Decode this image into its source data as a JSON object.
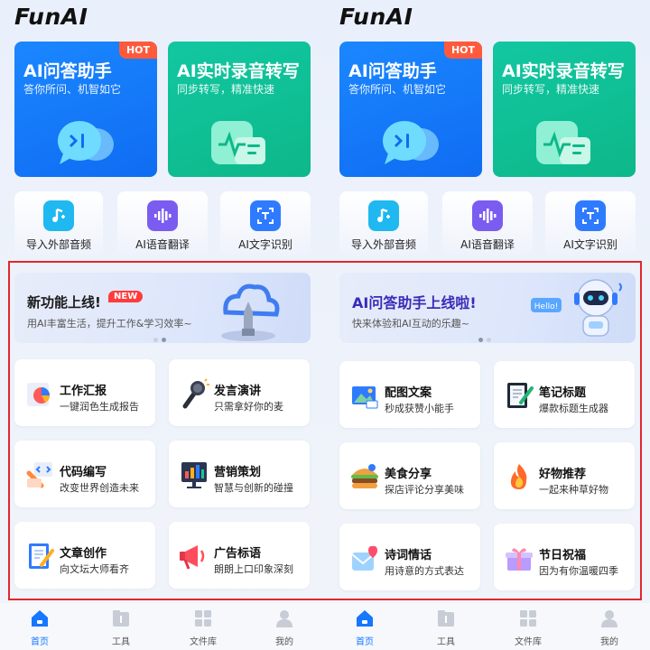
{
  "left": {
    "brand": "FunAI",
    "cards": [
      {
        "title": "AI问答助手",
        "subtitle": "答你所问、机智如它",
        "badge": "HOT",
        "icon": "chat-bubble-icon"
      },
      {
        "title": "AI实时录音转写",
        "subtitle": "同步转写，精准快速",
        "icon": "voice-transcribe-icon"
      }
    ],
    "tools": [
      {
        "label": "导入外部音频",
        "icon": "music-import-icon"
      },
      {
        "label": "AI语音翻译",
        "icon": "voice-wave-icon"
      },
      {
        "label": "AI文字识别",
        "icon": "text-scan-icon"
      }
    ],
    "banner": {
      "title": "新功能上线!",
      "badge": "NEW",
      "subtitle": "用AI丰富生活，提升工作&学习效率~",
      "icon": "cloud-rocket-icon"
    },
    "features": [
      {
        "title": "工作汇报",
        "subtitle": "一键润色生成报告",
        "icon": "report-chart-icon"
      },
      {
        "title": "发言演讲",
        "subtitle": "只需拿好你的麦",
        "icon": "microphone-icon"
      },
      {
        "title": "代码编写",
        "subtitle": "改变世界创造未来",
        "icon": "code-icon"
      },
      {
        "title": "营销策划",
        "subtitle": "智慧与创新的碰撞",
        "icon": "marketing-chart-icon"
      },
      {
        "title": "文章创作",
        "subtitle": "向文坛大师看齐",
        "icon": "article-pen-icon"
      },
      {
        "title": "广告标语",
        "subtitle": "朗朗上口印象深刻",
        "icon": "megaphone-icon"
      }
    ]
  },
  "right": {
    "brand": "FunAI",
    "cards": [
      {
        "title": "AI问答助手",
        "subtitle": "答你所问、机智如它",
        "badge": "HOT",
        "icon": "chat-bubble-icon"
      },
      {
        "title": "AI实时录音转写",
        "subtitle": "同步转写，精准快速",
        "icon": "voice-transcribe-icon"
      }
    ],
    "tools": [
      {
        "label": "导入外部音频",
        "icon": "music-import-icon"
      },
      {
        "label": "AI语音翻译",
        "icon": "voice-wave-icon"
      },
      {
        "label": "AI文字识别",
        "icon": "text-scan-icon"
      }
    ],
    "banner": {
      "title": "AI问答助手上线啦!",
      "subtitle": "快来体验和AI互动的乐趣~",
      "robot_text": "Hello!",
      "icon": "robot-icon"
    },
    "features": [
      {
        "title": "配图文案",
        "subtitle": "秒成获赞小能手",
        "icon": "image-caption-icon"
      },
      {
        "title": "笔记标题",
        "subtitle": "爆款标题生成器",
        "icon": "notebook-icon"
      },
      {
        "title": "美食分享",
        "subtitle": "探店评论分享美味",
        "icon": "burger-icon"
      },
      {
        "title": "好物推荐",
        "subtitle": "一起来种草好物",
        "icon": "fire-icon"
      },
      {
        "title": "诗词情话",
        "subtitle": "用诗意的方式表达",
        "icon": "love-letter-icon"
      },
      {
        "title": "节日祝福",
        "subtitle": "因为有你温暖四季",
        "icon": "gift-icon"
      }
    ]
  },
  "tabbar": [
    {
      "label": "首页",
      "icon": "home-icon",
      "active": true
    },
    {
      "label": "工具",
      "icon": "tools-icon"
    },
    {
      "label": "文件库",
      "icon": "file-library-icon"
    },
    {
      "label": "我的",
      "icon": "profile-icon"
    }
  ],
  "colors": {
    "accent": "#1677ff",
    "hot": "#ff5a3c",
    "blue_card": "#1b87ff",
    "green_card": "#12c7a2",
    "highlight_box": "#e3262e"
  }
}
